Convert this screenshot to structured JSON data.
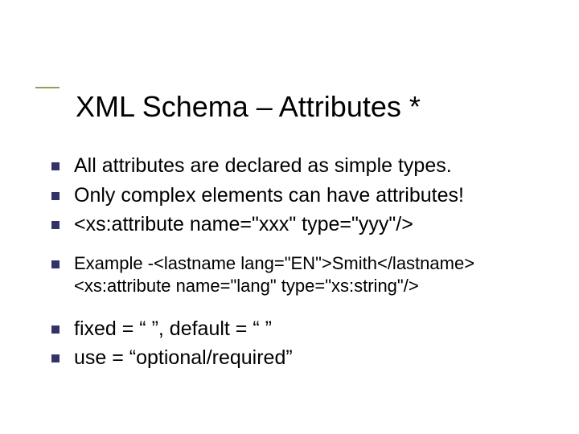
{
  "title": "XML Schema – Attributes *",
  "bullets": {
    "b1": "All attributes are declared as simple types.",
    "b2": "Only complex elements can have attributes!",
    "b3": "<xs:attribute name=\"xxx\" type=\"yyy\"/>",
    "b4a": "Example -<lastname lang=\"EN\">Smith</lastname>",
    "b4b": "<xs:attribute name=\"lang\" type=\"xs:string\"/>",
    "b5": "fixed = “ ”, default = “ ”",
    "b6": "use = “optional/required”"
  }
}
